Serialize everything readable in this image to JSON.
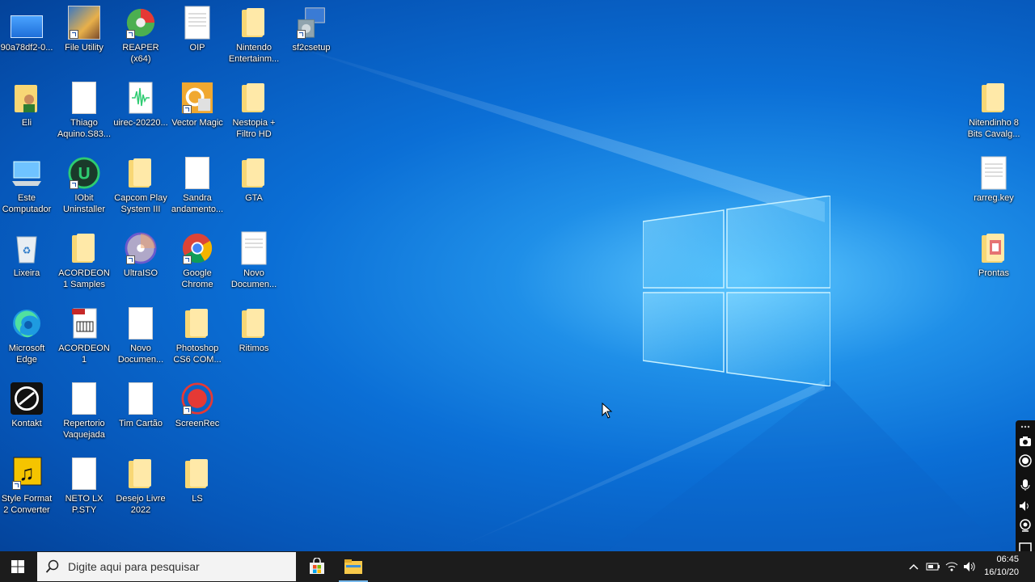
{
  "desktop": {
    "icons": [
      {
        "label": "90a78df2-0...",
        "kind": "image"
      },
      {
        "label": "File Utility",
        "kind": "app"
      },
      {
        "label": "REAPER (x64)",
        "kind": "app"
      },
      {
        "label": "OIP",
        "kind": "doc"
      },
      {
        "label": "Nintendo Entertainm...",
        "kind": "folder"
      },
      {
        "label": "sf2csetup",
        "kind": "installer"
      },
      {
        "label": "Eli",
        "kind": "folder"
      },
      {
        "label": "Thiago Aquino.S83...",
        "kind": "doc"
      },
      {
        "label": "uirec-20220...",
        "kind": "audio"
      },
      {
        "label": "Vector Magic",
        "kind": "app"
      },
      {
        "label": "Nestopia + Filtro HD",
        "kind": "folder"
      },
      {
        "label": "Este Computador",
        "kind": "computer"
      },
      {
        "label": "IObit Uninstaller",
        "kind": "app"
      },
      {
        "label": "Capcom Play System III",
        "kind": "folder"
      },
      {
        "label": "Sandra andamento...",
        "kind": "doc"
      },
      {
        "label": "GTA",
        "kind": "folder"
      },
      {
        "label": "Lixeira",
        "kind": "recycle"
      },
      {
        "label": "ACORDEON 1 Samples",
        "kind": "folder"
      },
      {
        "label": "UltraISO",
        "kind": "app"
      },
      {
        "label": "Google Chrome",
        "kind": "chrome"
      },
      {
        "label": "Novo Documen...",
        "kind": "doc"
      },
      {
        "label": "Microsoft Edge",
        "kind": "edge"
      },
      {
        "label": "ACORDEON 1",
        "kind": "doc"
      },
      {
        "label": "Novo Documen...",
        "kind": "doc"
      },
      {
        "label": "Photoshop CS6 COM...",
        "kind": "folder"
      },
      {
        "label": "Ritimos",
        "kind": "folder"
      },
      {
        "label": "Kontakt",
        "kind": "app"
      },
      {
        "label": "Repertorio Vaquejada",
        "kind": "doc"
      },
      {
        "label": "Tim Cartão",
        "kind": "doc"
      },
      {
        "label": "ScreenRec",
        "kind": "app"
      },
      {
        "label": "Style Format 2 Converter",
        "kind": "app"
      },
      {
        "label": "NETO LX P.STY",
        "kind": "doc"
      },
      {
        "label": "Desejo Livre 2022",
        "kind": "folder"
      },
      {
        "label": "LS",
        "kind": "folder"
      },
      {
        "label": "Nitendinho 8 Bits Cavalg...",
        "kind": "folder"
      },
      {
        "label": "rarreg.key",
        "kind": "doc"
      },
      {
        "label": "Prontas",
        "kind": "folder"
      }
    ]
  },
  "taskbar": {
    "search_placeholder": "Digite aqui para pesquisar",
    "apps": [
      {
        "name": "store-icon",
        "active": false
      },
      {
        "name": "file-explorer-icon",
        "active": true
      }
    ],
    "time": "06:45",
    "date": "16/10/20"
  },
  "colors": {
    "taskbar_bg": "#1c1c1c",
    "folder_yellow": "#f8d775",
    "accent": "#76b9ed"
  }
}
